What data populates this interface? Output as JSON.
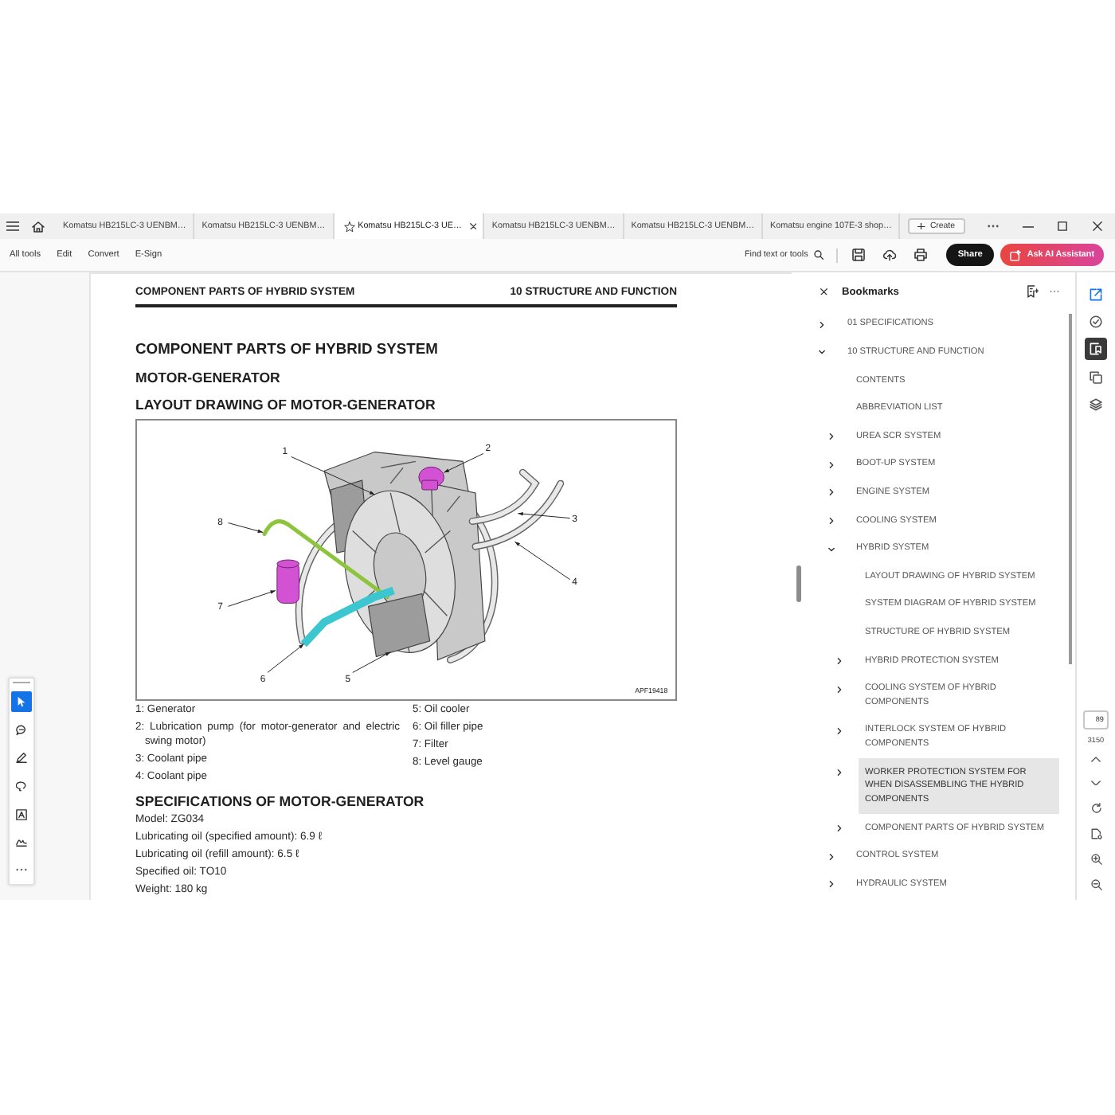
{
  "tabs": [
    {
      "title": "Komatsu HB215LC-3 UENBM…",
      "selected": false
    },
    {
      "title": "Komatsu HB215LC-3 UENBM…",
      "selected": false
    },
    {
      "title": "Komatsu HB215LC-3 UE…",
      "selected": true
    },
    {
      "title": "Komatsu HB215LC-3 UENBM…",
      "selected": false
    },
    {
      "title": "Komatsu HB215LC-3 UENBM…",
      "selected": false
    },
    {
      "title": "Komatsu engine 107E-3 shop…",
      "selected": false
    }
  ],
  "create_button": "Create",
  "toolbar": {
    "menu": [
      "All tools",
      "Edit",
      "Convert",
      "E-Sign"
    ],
    "find_button": "Find text or tools",
    "share_button": "Share",
    "ai_button": "Ask AI Assistant"
  },
  "left_tools": [
    {
      "kind": "select",
      "selected": true
    },
    {
      "kind": "comment",
      "selected": false
    },
    {
      "kind": "draw",
      "selected": false
    },
    {
      "kind": "shape",
      "selected": false
    },
    {
      "kind": "textbox",
      "selected": false
    },
    {
      "kind": "stamp",
      "selected": false
    },
    {
      "kind": "more",
      "selected": false
    }
  ],
  "document": {
    "running_header": {
      "left": "COMPONENT PARTS OF HYBRID SYSTEM",
      "right": "10 STRUCTURE AND FUNCTION"
    },
    "title": "COMPONENT PARTS OF HYBRID SYSTEM",
    "subtitle": "MOTOR-GENERATOR",
    "figure": {
      "heading": "LAYOUT DRAWING OF MOTOR-GENERATOR",
      "callouts": [
        "1",
        "2",
        "3",
        "4",
        "5",
        "6",
        "7",
        "8"
      ],
      "code": "APF19418"
    },
    "legend_columns": [
      [
        "1: Generator",
        "2: Lubrication pump (for motor-generator and electric swing motor)",
        "3: Coolant pipe",
        "4: Coolant pipe"
      ],
      [
        "5: Oil cooler",
        "6: Oil filler pipe",
        "7: Filter",
        "8: Level gauge"
      ]
    ],
    "specs": {
      "heading": "SPECIFICATIONS OF MOTOR-GENERATOR",
      "lines": [
        "Model: ZG034",
        "Lubricating oil (specified amount): 6.9 ℓ",
        "Lubricating oil (refill amount): 6.5 ℓ",
        "Specified oil: TO10",
        "Weight: 180 kg"
      ]
    }
  },
  "bookmarks": {
    "title": "Bookmarks",
    "items": [
      {
        "title": "01 SPECIFICATIONS",
        "kind": "branch",
        "expanded": false,
        "selected": false
      },
      {
        "title": "10 STRUCTURE AND FUNCTION",
        "kind": "branch",
        "expanded": true,
        "selected": false,
        "children": [
          {
            "title": "CONTENTS",
            "kind": "leaf",
            "selected": false
          },
          {
            "title": "ABBREVIATION LIST",
            "kind": "leaf",
            "selected": false
          },
          {
            "title": "UREA SCR SYSTEM",
            "kind": "branch",
            "expanded": false,
            "selected": false
          },
          {
            "title": "BOOT-UP SYSTEM",
            "kind": "branch",
            "expanded": false,
            "selected": false
          },
          {
            "title": "ENGINE SYSTEM",
            "kind": "branch",
            "expanded": false,
            "selected": false
          },
          {
            "title": "COOLING SYSTEM",
            "kind": "branch",
            "expanded": false,
            "selected": false
          },
          {
            "title": "HYBRID SYSTEM",
            "kind": "branch",
            "expanded": true,
            "selected": false,
            "children": [
              {
                "title": "LAYOUT DRAWING OF HYBRID SYSTEM",
                "kind": "leaf",
                "selected": false
              },
              {
                "title": "SYSTEM DIAGRAM OF HYBRID SYSTEM",
                "kind": "leaf",
                "selected": false
              },
              {
                "title": "STRUCTURE OF HYBRID SYSTEM",
                "kind": "leaf",
                "selected": false
              },
              {
                "title": "HYBRID PROTECTION SYSTEM",
                "kind": "branch",
                "expanded": false,
                "selected": false
              },
              {
                "title": "COOLING SYSTEM OF HYBRID COMPONENTS",
                "kind": "branch",
                "expanded": false,
                "selected": false
              },
              {
                "title": "INTERLOCK SYSTEM OF HYBRID COMPONENTS",
                "kind": "branch",
                "expanded": false,
                "selected": false
              },
              {
                "title": "WORKER PROTECTION SYSTEM FOR WHEN DISASSEMBLING THE HYBRID COMPONENTS",
                "kind": "branch",
                "expanded": false,
                "selected": true
              },
              {
                "title": "COMPONENT PARTS OF HYBRID SYSTEM",
                "kind": "branch",
                "expanded": false,
                "selected": false
              }
            ]
          },
          {
            "title": "CONTROL SYSTEM",
            "kind": "branch",
            "expanded": false,
            "selected": false
          },
          {
            "title": "HYDRAULIC SYSTEM",
            "kind": "branch",
            "expanded": false,
            "selected": false
          }
        ]
      }
    ]
  },
  "right_panels": [
    {
      "kind": "edit",
      "selected": false
    },
    {
      "kind": "review",
      "selected": false
    },
    {
      "kind": "bookmarks",
      "selected": true
    },
    {
      "kind": "pages",
      "selected": false
    },
    {
      "kind": "layers",
      "selected": false
    }
  ],
  "page_navigation": {
    "current_page": "89",
    "total_pages": "3150"
  }
}
